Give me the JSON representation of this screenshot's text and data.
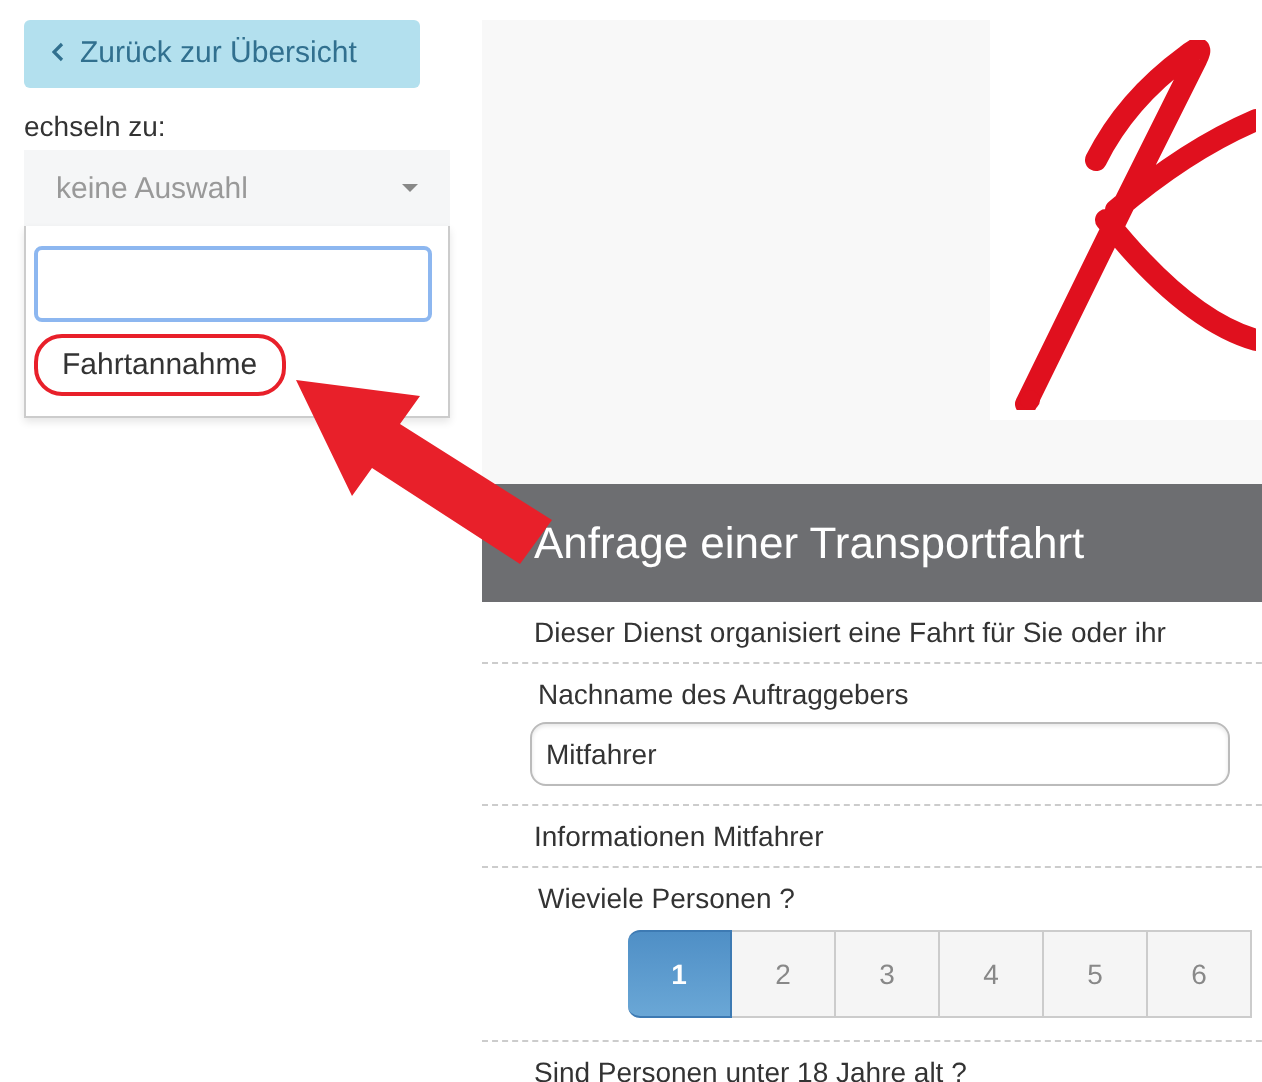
{
  "sidebar": {
    "back_button": "Zurück zur Übersicht",
    "switch_label": "echseln zu:",
    "select": {
      "value": "keine Auswahl",
      "expanded": true,
      "options": [
        {
          "label": "Fahrtannahme",
          "highlighted": true
        }
      ]
    }
  },
  "annotation": {
    "arrow": true
  },
  "form": {
    "title": "Anfrage einer Transportfahrt",
    "intro": "Dieser Dienst organisiert eine Fahrt für Sie oder ihr",
    "fields": [
      {
        "kind": "text",
        "label": "Nachname des Auftraggebers",
        "value": "Mitfahrer"
      },
      {
        "kind": "heading",
        "label": "Informationen Mitfahrer"
      },
      {
        "kind": "choice",
        "label": "Wieviele Personen ?",
        "options": [
          {
            "label": "1",
            "selected": true
          },
          {
            "label": "2",
            "selected": false
          },
          {
            "label": "3",
            "selected": false
          },
          {
            "label": "4",
            "selected": false
          },
          {
            "label": "5",
            "selected": false
          },
          {
            "label": "6",
            "selected": false
          }
        ]
      },
      {
        "kind": "heading",
        "label": "Sind Personen unter 18 Jahre alt ?"
      }
    ]
  }
}
